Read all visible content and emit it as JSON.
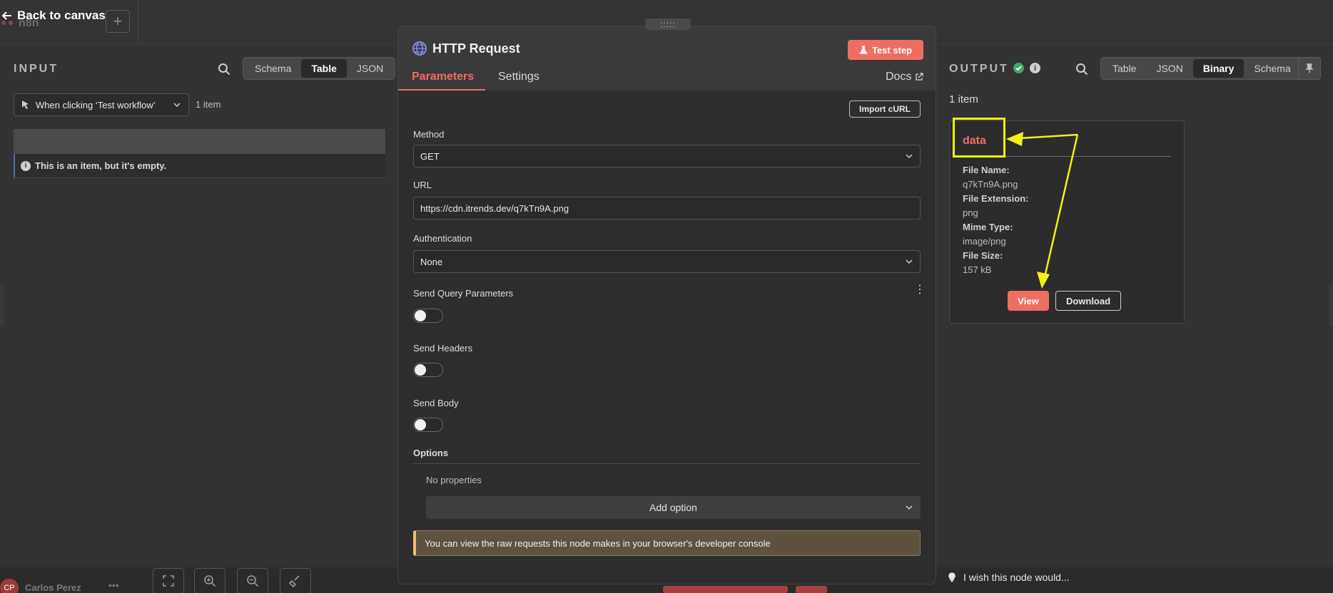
{
  "topbar": {
    "app_name": "n8n",
    "back_label": "Back to canvas",
    "add_symbol": "+"
  },
  "user": {
    "initials": "CP",
    "name": "Carlos Perez",
    "more": "•••"
  },
  "input_panel": {
    "title": "INPUT",
    "tabs": [
      "Schema",
      "Table",
      "JSON"
    ],
    "active_tab": "Table",
    "trigger_label": "When clicking ‘Test workflow’",
    "item_count": "1 item",
    "empty_message": "This is an item, but it's empty."
  },
  "modal": {
    "drag_label": ":::::",
    "title": "HTTP Request",
    "test_step_label": "Test step",
    "tabs": {
      "parameters": "Parameters",
      "settings": "Settings"
    },
    "docs_label": "Docs",
    "import_curl_label": "Import cURL",
    "fields": {
      "method": {
        "label": "Method",
        "value": "GET"
      },
      "url": {
        "label": "URL",
        "value": "https://cdn.itrends.dev/q7kTn9A.png"
      },
      "authentication": {
        "label": "Authentication",
        "value": "None"
      },
      "send_query_parameters": {
        "label": "Send Query Parameters",
        "on": false
      },
      "send_headers": {
        "label": "Send Headers",
        "on": false
      },
      "send_body": {
        "label": "Send Body",
        "on": false
      }
    },
    "options": {
      "label": "Options",
      "empty_text": "No properties",
      "add_option_label": "Add option"
    },
    "notice": "You can view the raw requests this node makes in your browser's developer console"
  },
  "output_panel": {
    "title": "OUTPUT",
    "tabs": [
      "Table",
      "JSON",
      "Binary",
      "Schema"
    ],
    "active_tab": "Binary",
    "item_count": "1 item",
    "binary": {
      "title": "data",
      "file_name_label": "File Name:",
      "file_name": "q7kTn9A.png",
      "file_extension_label": "File Extension:",
      "file_extension": "png",
      "mime_type_label": "Mime Type:",
      "mime_type": "image/png",
      "file_size_label": "File Size:",
      "file_size": "157 kB",
      "view_label": "View",
      "download_label": "Download"
    },
    "feedback": "I wish this node would..."
  },
  "colors": {
    "accent": "#ef6e63",
    "success": "#3fa76a",
    "annotation": "#f5f016",
    "globe": "#8a8ef0"
  }
}
